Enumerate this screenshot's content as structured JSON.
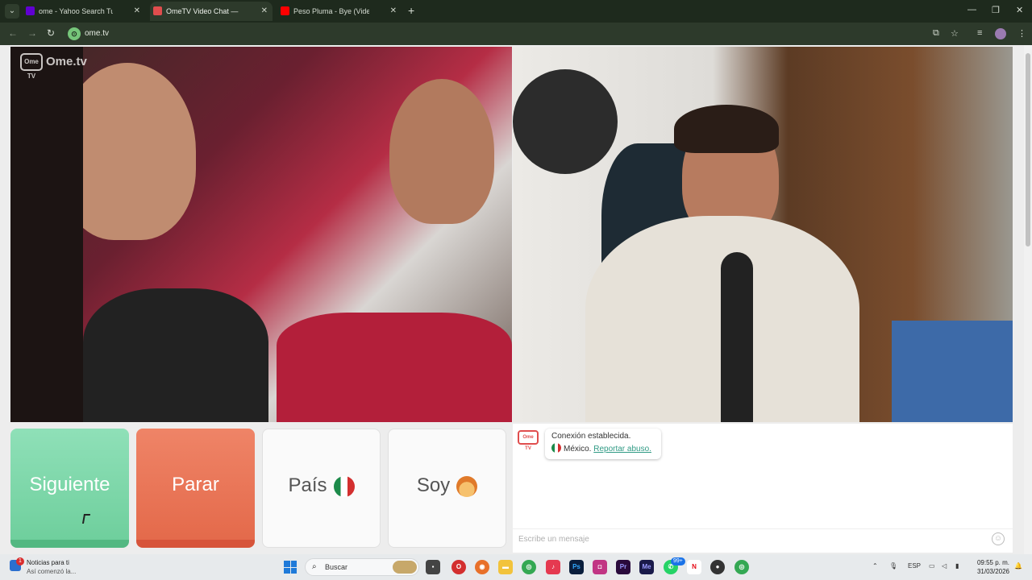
{
  "browser": {
    "tabs": [
      {
        "title": "ome - Yahoo Search Tus resulta",
        "favicon_color": "#6001d2",
        "active": false
      },
      {
        "title": "OmeTV Video Chat — Ome",
        "favicon_color": "#e04d4d",
        "active": true
      },
      {
        "title": "Peso Pluma - Bye (Video Oficial",
        "favicon_color": "#ff0000",
        "active": false
      }
    ],
    "url": "ome.tv"
  },
  "ometv": {
    "logo": "Ome.tv",
    "logo_icon_text": "Ome TV",
    "buttons": {
      "next": "Siguiente",
      "stop": "Parar",
      "country": "País",
      "gender": "Soy"
    },
    "chat": {
      "status": "Conexión establecida.",
      "country": "México.",
      "report": "Reportar abuso.",
      "placeholder": "Escribe un mensaje",
      "avatar_text": "Ome TV"
    }
  },
  "taskbar": {
    "news_title": "Noticias para ti",
    "news_sub": "Así comenzó la...",
    "news_badge": "1",
    "search_label": "Buscar",
    "whatsapp_badge": "99+",
    "lang": "ESP",
    "time": "09:55 p. m.",
    "date": "31/03/2026"
  },
  "colors": {
    "next": "#6fcf9d",
    "stop": "#e46a4b",
    "report_link": "#2f9a84",
    "browser_frame": "#1e2a1d"
  }
}
